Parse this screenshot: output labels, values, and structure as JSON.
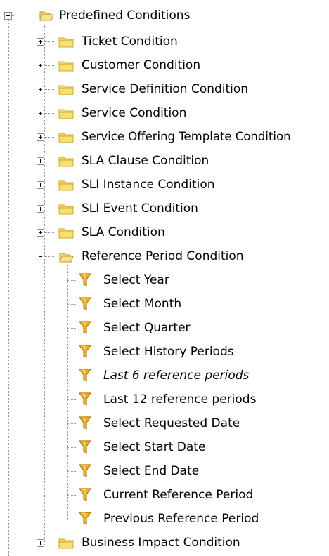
{
  "tree": {
    "root": {
      "label": "Predefined Conditions",
      "icon": "folder-open-icon",
      "expanded": true
    },
    "children": [
      {
        "label": "Ticket Condition",
        "icon": "folder-icon",
        "expanded": false
      },
      {
        "label": "Customer Condition",
        "icon": "folder-icon",
        "expanded": false
      },
      {
        "label": "Service Definition Condition",
        "icon": "folder-icon",
        "expanded": false
      },
      {
        "label": "Service Condition",
        "icon": "folder-icon",
        "expanded": false
      },
      {
        "label": "Service Offering Template Condition",
        "icon": "folder-icon",
        "expanded": false
      },
      {
        "label": "SLA Clause Condition",
        "icon": "folder-icon",
        "expanded": false
      },
      {
        "label": "SLI Instance Condition",
        "icon": "folder-icon",
        "expanded": false
      },
      {
        "label": "SLI Event Condition",
        "icon": "folder-icon",
        "expanded": false
      },
      {
        "label": "SLA Condition",
        "icon": "folder-icon",
        "expanded": false
      },
      {
        "label": "Reference Period Condition",
        "icon": "folder-open-icon",
        "expanded": true,
        "items": [
          {
            "label": "Select Year",
            "icon": "filter-icon"
          },
          {
            "label": "Select Month",
            "icon": "filter-icon"
          },
          {
            "label": "Select Quarter",
            "icon": "filter-icon"
          },
          {
            "label": "Select History Periods",
            "icon": "filter-icon"
          },
          {
            "label": "Last 6 reference periods",
            "icon": "filter-icon",
            "italic": true
          },
          {
            "label": "Last 12 reference periods",
            "icon": "filter-icon"
          },
          {
            "label": "Select Requested Date",
            "icon": "filter-icon"
          },
          {
            "label": "Select Start Date",
            "icon": "filter-icon"
          },
          {
            "label": "Select End Date",
            "icon": "filter-icon"
          },
          {
            "label": "Current Reference Period",
            "icon": "filter-icon"
          },
          {
            "label": "Previous Reference Period",
            "icon": "filter-icon"
          }
        ]
      },
      {
        "label": "Business Impact Condition",
        "icon": "folder-icon",
        "expanded": false
      }
    ]
  },
  "colors": {
    "folder_fill": "#f6d55c",
    "folder_edge": "#d0a82a",
    "filter_fill": "#f2b01e",
    "filter_edge": "#b77b06",
    "tree_line": "#9a9a9a"
  }
}
